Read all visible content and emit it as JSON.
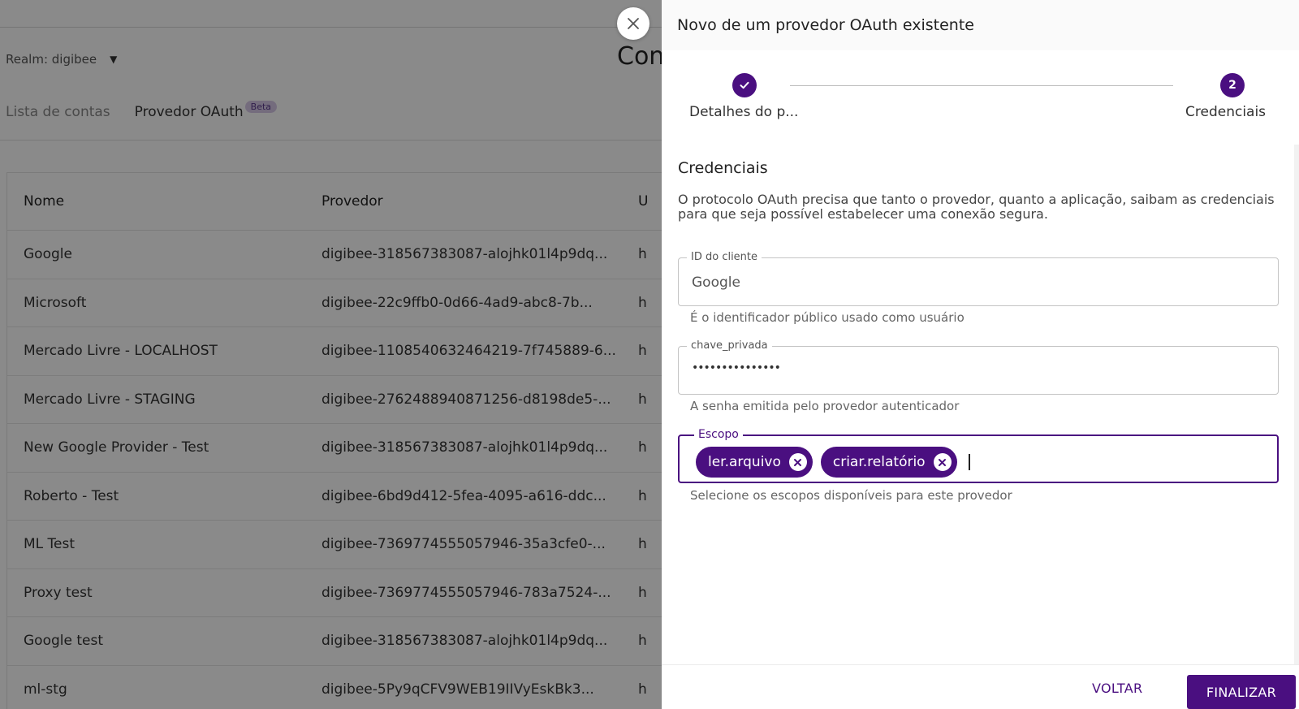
{
  "background": {
    "realm_label": "Realm: digibee",
    "page_title_partial": "Con",
    "tabs": [
      {
        "label": "Lista de contas"
      },
      {
        "label": "Provedor OAuth",
        "badge": "Beta"
      }
    ],
    "table": {
      "headers": [
        "Nome",
        "Provedor",
        "U"
      ],
      "rows": [
        {
          "name": "Google",
          "provider": "digibee-318567383087-alojhk01l4p9dq...",
          "third": "h"
        },
        {
          "name": "Microsoft",
          "provider": "digibee-22c9ffb0-0d66-4ad9-abc8-7b...",
          "third": "h"
        },
        {
          "name": "Mercado Livre - LOCALHOST",
          "provider": "digibee-1108540632464219-7f745889-6...",
          "third": "h"
        },
        {
          "name": "Mercado Livre - STAGING",
          "provider": "digibee-2762488940871256-d8198de5-...",
          "third": "h"
        },
        {
          "name": "New Google Provider - Test",
          "provider": "digibee-318567383087-alojhk01l4p9dq...",
          "third": "h"
        },
        {
          "name": "Roberto - Test",
          "provider": "digibee-6bd9d412-5fea-4095-a616-ddc...",
          "third": "h"
        },
        {
          "name": "ML Test",
          "provider": "digibee-7369774555057946-35a3cfe0-...",
          "third": "h"
        },
        {
          "name": "Proxy test",
          "provider": "digibee-7369774555057946-783a7524-...",
          "third": "h"
        },
        {
          "name": "Google test",
          "provider": "digibee-318567383087-alojhk01l4p9dq...",
          "third": "h"
        },
        {
          "name": "ml-stg",
          "provider": "digibee-5Py9qCFV9WEB19IIVyEskBk3...",
          "third": "h"
        }
      ]
    }
  },
  "drawer": {
    "title": "Novo de um provedor OAuth existente",
    "steps": [
      {
        "label": "Detalhes do p...",
        "state": "completed"
      },
      {
        "label": "Credenciais",
        "number": "2",
        "state": "active"
      }
    ],
    "section_title": "Credenciais",
    "section_description": "O protocolo OAuth precisa que tanto o provedor, quanto a aplicação, saibam as credenciais para que seja possível estabelecer uma conexão segura.",
    "fields": {
      "client_id": {
        "label": "ID do cliente",
        "value": "Google",
        "helper": "É o identificador público usado como usuário"
      },
      "private_key": {
        "label": "chave_privada",
        "value": "•••••••••••••••",
        "helper": "A senha emitida pelo provedor autenticador"
      },
      "scope": {
        "label": "Escopo",
        "chips": [
          "ler.arquivo",
          "criar.relatório"
        ],
        "helper": "Selecione os escopos disponíveis para este provedor"
      }
    },
    "footer": {
      "back_label": "VOLTAR",
      "finish_label": "FINALIZAR"
    }
  },
  "colors": {
    "accent": "#4a0f80",
    "overlay": "rgba(0,0,0,0.46)"
  },
  "icons": {
    "close": "close-icon",
    "check": "check-icon",
    "chip_remove": "remove-chip-icon",
    "dropdown": "chevron-down-icon"
  }
}
